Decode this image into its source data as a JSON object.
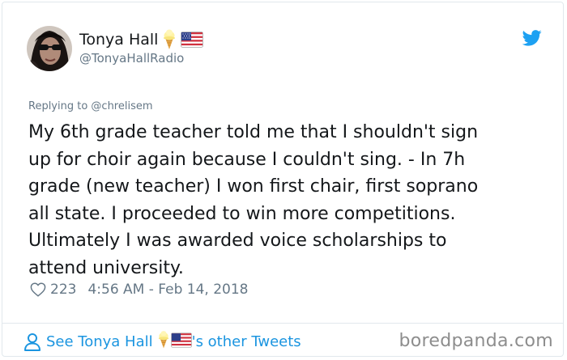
{
  "author": {
    "display_name": "Tonya Hall",
    "handle": "@TonyaHallRadio",
    "emoji_icons": [
      "ice-cream-icon",
      "us-flag-icon"
    ]
  },
  "tweet": {
    "replying_to": "Replying to @chrelisem",
    "text": "My 6th grade teacher told me that I shouldn't sign\nup for choir again because I couldn't sing. - In 7h\ngrade (new teacher) I won first chair, first soprano\nall state. I proceeded to win more competitions.\nUltimately I was awarded voice scholarships to\nattend university.",
    "likes": "223",
    "timestamp": "4:56 AM - Feb 14, 2018"
  },
  "footer": {
    "see_prefix": "See Tonya Hall",
    "see_suffix": "'s other Tweets"
  },
  "watermark": "boredpanda.com",
  "colors": {
    "link": "#1b95e0",
    "muted": "#657786",
    "text": "#14171a",
    "twitter_blue": "#1da1f2",
    "border": "#e1e8ed"
  }
}
